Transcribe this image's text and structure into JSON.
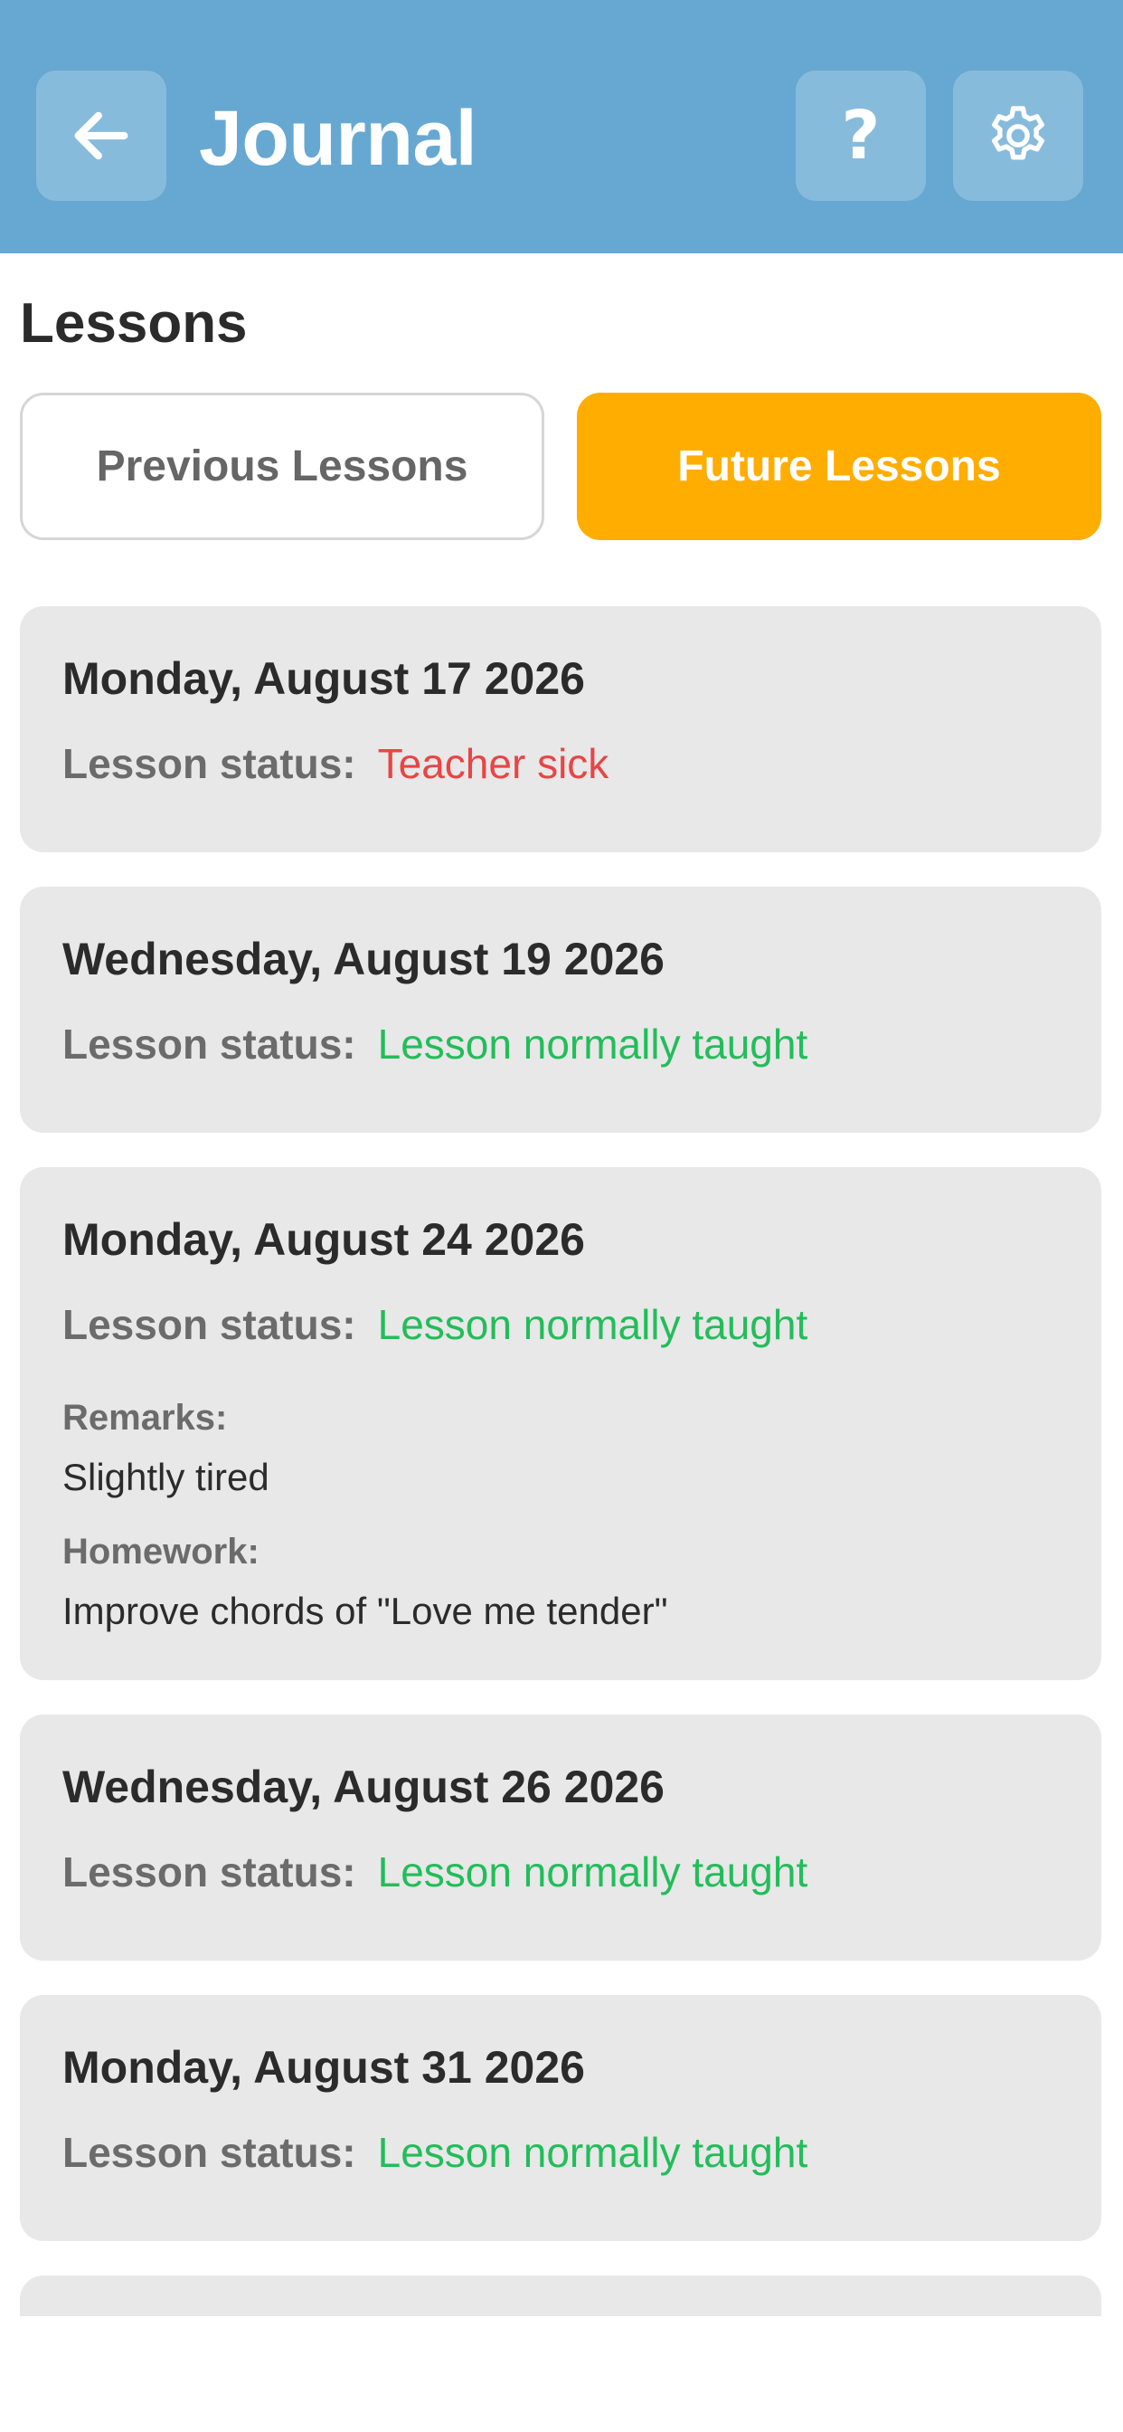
{
  "header": {
    "title": "Journal",
    "help_label": "?",
    "background_color": "#66a8d2"
  },
  "lessons": {
    "section_title": "Lessons",
    "tabs": {
      "previous": "Previous Lessons",
      "future": "Future Lessons",
      "active": "future",
      "active_color": "#ffad00"
    },
    "status_label": "Lesson status:",
    "remarks_label": "Remarks:",
    "homework_label": "Homework:",
    "items": [
      {
        "date": "Monday, August 17 2026",
        "status": "Teacher sick",
        "status_color": "#e84545"
      },
      {
        "date": "Wednesday, August 19 2026",
        "status": "Lesson normally taught",
        "status_color": "#22bd5a"
      },
      {
        "date": "Monday, August 24 2026",
        "status": "Lesson normally taught",
        "status_color": "#22bd5a",
        "remarks": "Slightly tired",
        "homework": "Improve chords of \"Love me tender\""
      },
      {
        "date": "Wednesday, August 26 2026",
        "status": "Lesson normally taught",
        "status_color": "#22bd5a"
      },
      {
        "date": "Monday, August 31 2026",
        "status": "Lesson normally taught",
        "status_color": "#22bd5a"
      }
    ]
  },
  "icons": {
    "back": "arrow-left-icon",
    "help": "question-mark-icon",
    "settings": "gear-icon"
  }
}
